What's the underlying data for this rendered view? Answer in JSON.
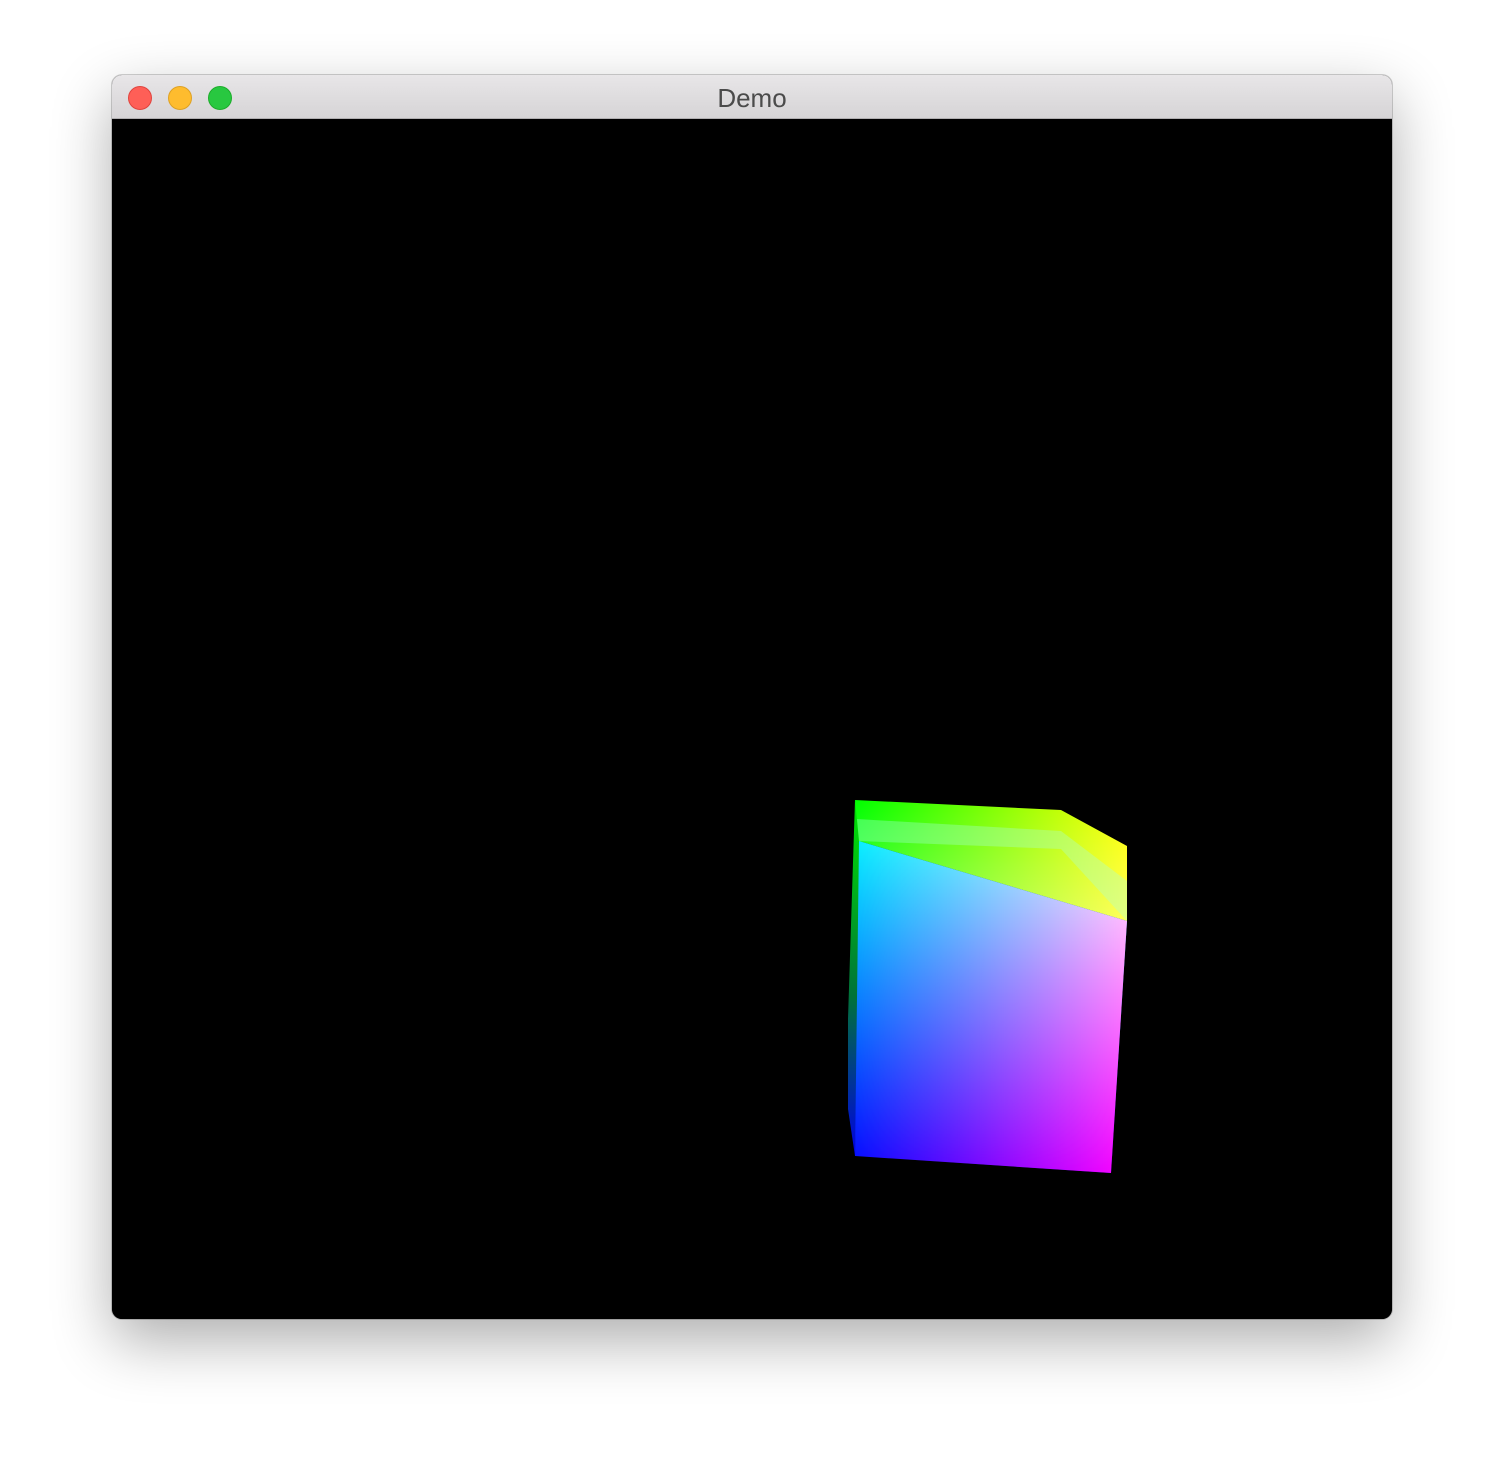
{
  "window": {
    "title": "Demo",
    "controls": {
      "close_color": "#fe5f57",
      "minimize_color": "#febc2e",
      "maximize_color": "#28c840"
    }
  },
  "viewport": {
    "background": "#000000",
    "object": "rgb-color-cube",
    "visible_faces": [
      "front-face",
      "top-face",
      "left-face"
    ],
    "corner_colors": {
      "front_top_left": "#00ffff",
      "front_top_right": "#ffffff",
      "front_bottom_left": "#0000ff",
      "front_bottom_right": "#ff00ff",
      "back_top_left": "#00ff00",
      "back_top_right": "#ffff00"
    }
  }
}
